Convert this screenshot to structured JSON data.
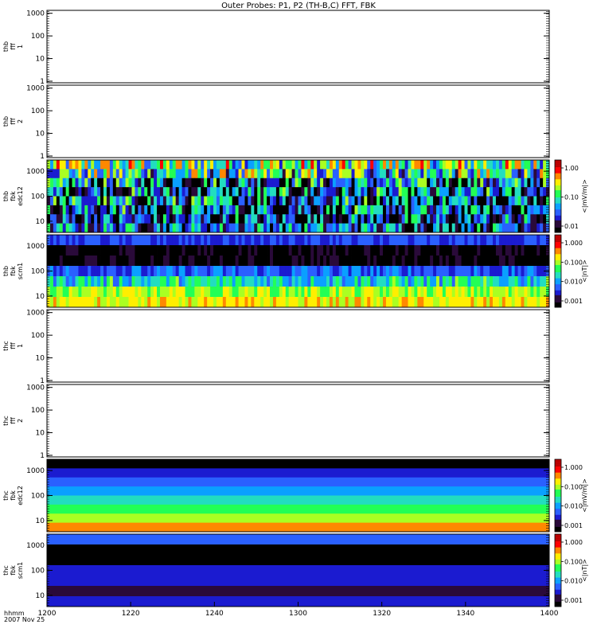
{
  "title": "Outer Probes: P1, P2 (TH-B,C) FFT, FBK",
  "footer": {
    "label_line1": "hhmm",
    "label_line2": "2007 Nov 25"
  },
  "colors": {
    "spectrogram_scale": [
      "#000000",
      "#2a0a3a",
      "#1b1bd0",
      "#2a60ff",
      "#0aa0ff",
      "#22ddc0",
      "#22ff55",
      "#aaff22",
      "#ffee00",
      "#ff8800",
      "#ff0000",
      "#bb0000"
    ]
  },
  "chart_data": {
    "type": "heatmap",
    "x_ticks": [
      "1200",
      "1220",
      "1240",
      "1300",
      "1320",
      "1340",
      "1400"
    ],
    "panels": [
      {
        "id": "thb-fff1",
        "ylabel": [
          "thb",
          "fff",
          "1"
        ],
        "yticks": [
          "1",
          "10",
          "100",
          "1000"
        ],
        "empty": true
      },
      {
        "id": "thb-fff2",
        "ylabel": [
          "thb",
          "fff",
          "2"
        ],
        "yticks": [
          "1",
          "10",
          "100",
          "1000"
        ],
        "empty": true
      },
      {
        "id": "thb-edc12",
        "ylabel": [
          "thb",
          "fbk",
          "edc12"
        ],
        "yticks": [
          "10",
          "100",
          "1000"
        ],
        "colorbar": {
          "label": "<|mV/m|>",
          "ticks": [
            "1.00",
            "0.10",
            "0.01"
          ]
        },
        "bands": [
          {
            "level": 0.55,
            "noise": 0.7
          },
          {
            "level": 0.45,
            "noise": 0.7
          },
          {
            "level": 0.3,
            "noise": 0.7
          },
          {
            "level": 0.25,
            "noise": 0.7
          },
          {
            "level": 0.3,
            "noise": 0.7
          },
          {
            "level": 0.25,
            "noise": 0.7
          },
          {
            "level": 0.2,
            "noise": 0.7
          },
          {
            "level": 0.3,
            "noise": 0.5
          }
        ]
      },
      {
        "id": "thb-scm1",
        "ylabel": [
          "thb",
          "fbk",
          "scm1"
        ],
        "yticks": [
          "10",
          "100",
          "1000"
        ],
        "colorbar": {
          "label": "<|nT|>",
          "ticks": [
            "1.000",
            "0.100",
            "0.010",
            "0.001"
          ]
        },
        "bands": [
          {
            "level": 0.25,
            "noise": 0.1
          },
          {
            "level": 0.05,
            "noise": 0.15
          },
          {
            "level": 0.05,
            "noise": 0.15
          },
          {
            "level": 0.28,
            "noise": 0.2
          },
          {
            "level": 0.45,
            "noise": 0.3
          },
          {
            "level": 0.62,
            "noise": 0.2
          },
          {
            "level": 0.7,
            "noise": 0.15
          }
        ]
      },
      {
        "id": "thc-fff1",
        "ylabel": [
          "thc",
          "fff",
          "1"
        ],
        "yticks": [
          "1",
          "10",
          "100",
          "1000"
        ],
        "empty": true
      },
      {
        "id": "thc-fff2",
        "ylabel": [
          "thc",
          "fff",
          "2"
        ],
        "yticks": [
          "1",
          "10",
          "100",
          "1000"
        ],
        "empty": true
      },
      {
        "id": "thc-edc12",
        "ylabel": [
          "thc",
          "fbk",
          "edc12"
        ],
        "yticks": [
          "10",
          "100",
          "1000"
        ],
        "colorbar": {
          "label": "<|mV/m|>",
          "ticks": [
            "1.000",
            "0.100",
            "0.010",
            "0.001"
          ]
        },
        "bands": [
          {
            "level": 0.05,
            "noise": 0
          },
          {
            "level": 0.22,
            "noise": 0
          },
          {
            "level": 0.28,
            "noise": 0
          },
          {
            "level": 0.38,
            "noise": 0
          },
          {
            "level": 0.42,
            "noise": 0
          },
          {
            "level": 0.55,
            "noise": 0
          },
          {
            "level": 0.6,
            "noise": 0
          },
          {
            "level": 0.78,
            "noise": 0
          }
        ]
      },
      {
        "id": "thc-scm1",
        "ylabel": [
          "thc",
          "fbk",
          "scm1"
        ],
        "yticks": [
          "10",
          "100",
          "1000"
        ],
        "colorbar": {
          "label": "<|nT|>",
          "ticks": [
            "1.000",
            "0.100",
            "0.010",
            "0.001"
          ]
        },
        "bands": [
          {
            "level": 0.3,
            "noise": 0
          },
          {
            "level": 0.05,
            "noise": 0
          },
          {
            "level": 0.05,
            "noise": 0
          },
          {
            "level": 0.2,
            "noise": 0
          },
          {
            "level": 0.2,
            "noise": 0
          },
          {
            "level": 0.15,
            "noise": 0
          },
          {
            "level": 0.2,
            "noise": 0
          }
        ]
      }
    ]
  }
}
